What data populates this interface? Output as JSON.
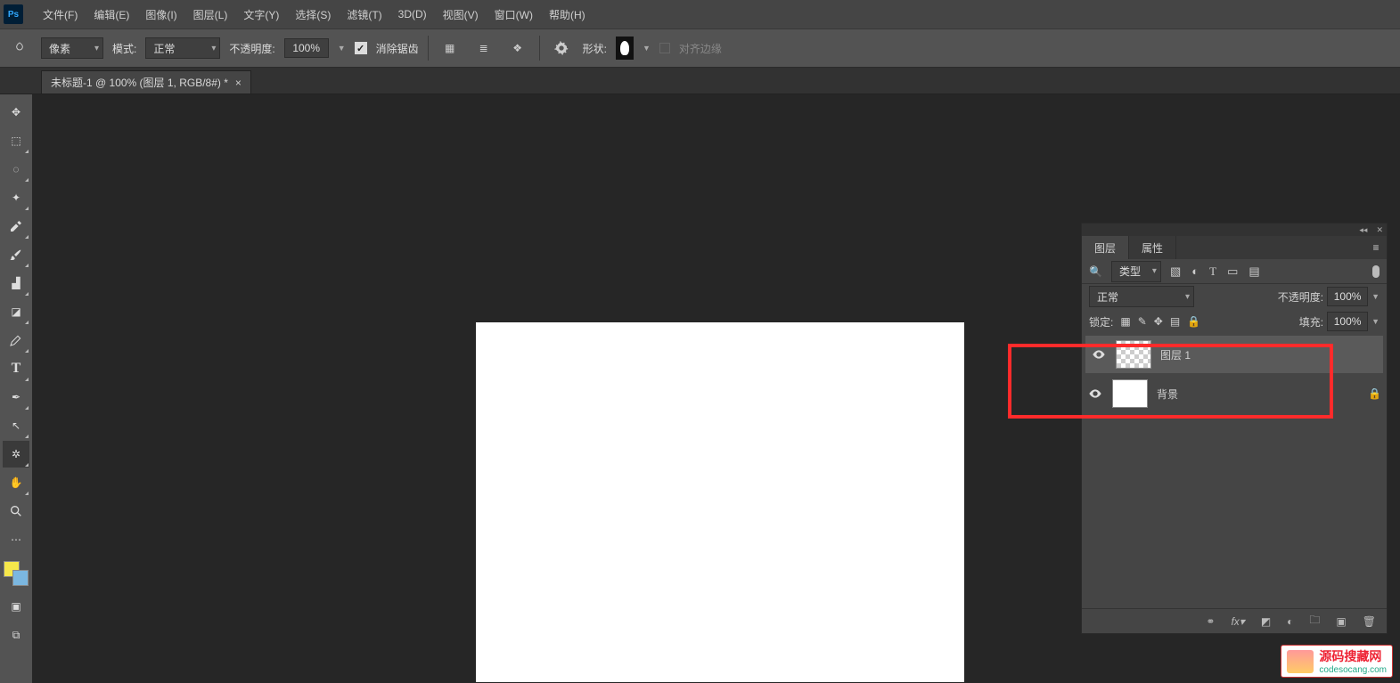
{
  "menu": {
    "items": [
      "文件(F)",
      "编辑(E)",
      "图像(I)",
      "图层(L)",
      "文字(Y)",
      "选择(S)",
      "滤镜(T)",
      "3D(D)",
      "视图(V)",
      "窗口(W)",
      "帮助(H)"
    ]
  },
  "optionsbar": {
    "unit_dd": "像素",
    "mode_label": "模式:",
    "mode_value": "正常",
    "opacity_label": "不透明度:",
    "opacity_value": "100%",
    "antialias_label": "消除锯齿",
    "shape_label": "形状:",
    "align_label": "对齐边缘"
  },
  "document": {
    "tab_title": "未标题-1 @ 100% (图层 1, RGB/8#) *"
  },
  "layers_panel": {
    "tabs": [
      "图层",
      "属性"
    ],
    "filter_label": "类型",
    "blend_mode": "正常",
    "opacity_label": "不透明度:",
    "opacity_value": "100%",
    "lock_label": "锁定:",
    "fill_label": "填充:",
    "fill_value": "100%",
    "layers": [
      {
        "name": "图层 1",
        "selected": true,
        "visible": true,
        "checker": true
      },
      {
        "name": "背景",
        "selected": false,
        "visible": true,
        "checker": false,
        "locked": true
      }
    ],
    "footer_icons": [
      "link",
      "fx",
      "mask",
      "adjust",
      "group",
      "new",
      "trash"
    ]
  },
  "watermark": {
    "title": "源码搜藏网",
    "url": "codesocang.com"
  },
  "toolbar_tools": [
    "move",
    "marquee",
    "lasso",
    "magic-wand",
    "crop",
    "eyedropper",
    "healing",
    "brush",
    "clone",
    "eraser",
    "shape",
    "text",
    "pen",
    "path-select",
    "custom-shape",
    "hand",
    "zoom",
    "more",
    "ruler"
  ]
}
